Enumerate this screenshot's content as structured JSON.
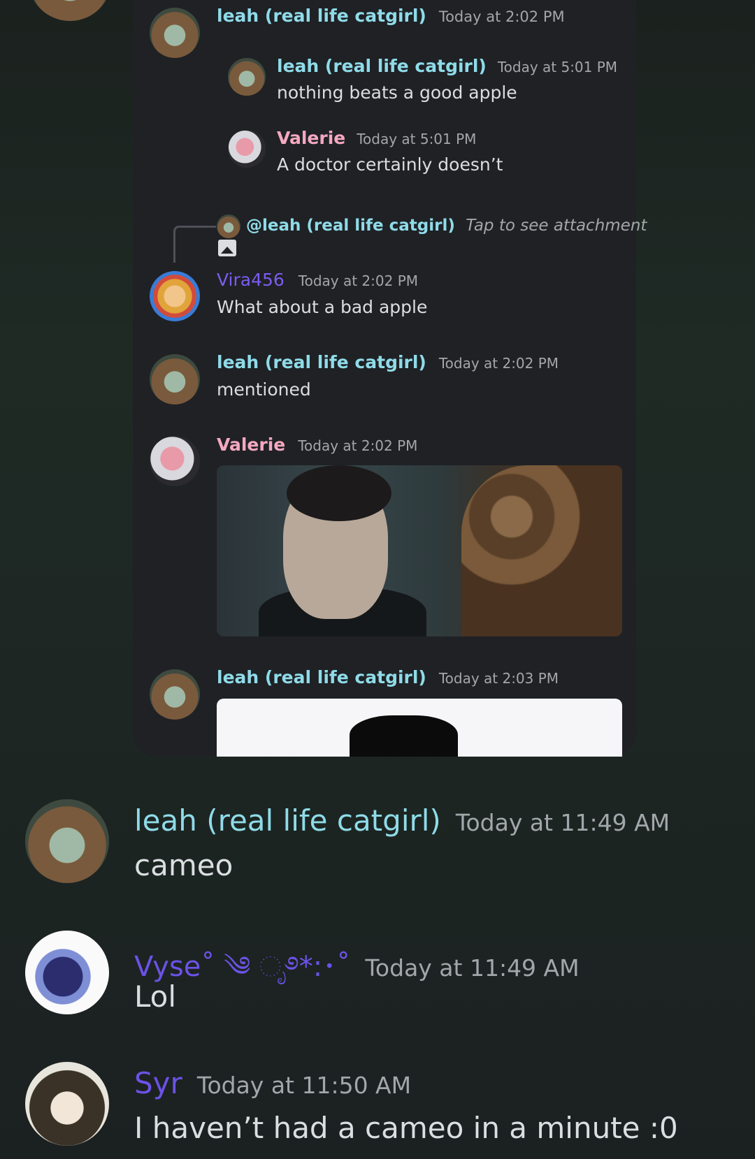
{
  "embed": {
    "messages": [
      {
        "author": "leah (real life catgirl)",
        "time": "Today at 2:02 PM"
      },
      {
        "author": "leah (real life catgirl)",
        "time": "Today at 5:01 PM",
        "text": "nothing beats a good apple"
      },
      {
        "author": "Valerie",
        "time": "Today at 5:01 PM",
        "text": "A doctor certainly doesn’t"
      },
      {
        "reply_to": "@leah (real life catgirl)",
        "reply_hint": "Tap to see attachment"
      },
      {
        "author": "Vira456",
        "time": "Today at 2:02 PM",
        "text": "What about a bad apple"
      },
      {
        "author": "leah (real life catgirl)",
        "time": "Today at 2:02 PM",
        "text": "mentioned"
      },
      {
        "author": "Valerie",
        "time": "Today at 2:02 PM"
      },
      {
        "author": "leah (real life catgirl)",
        "time": "Today at 2:03 PM"
      }
    ]
  },
  "messages": [
    {
      "author": "leah (real life catgirl)",
      "time": "Today at 11:49 AM",
      "text": "cameo"
    },
    {
      "author": "Vyse˚ ༄ ೃ࿔*:･˚",
      "time": "Today at 11:49 AM",
      "text": "Lol"
    },
    {
      "author": "Syr",
      "time": "Today at 11:50 AM",
      "text": "I haven’t had a cameo in a minute :0"
    }
  ],
  "colors": {
    "background": "#1d2623",
    "embed_background": "#1f2125",
    "leah_name": "#8fdbe8",
    "valerie_name": "#f4a8c0",
    "purple_name": "#6b52e6",
    "timestamp": "#a3a6aa",
    "message_text": "#dbdee1"
  }
}
